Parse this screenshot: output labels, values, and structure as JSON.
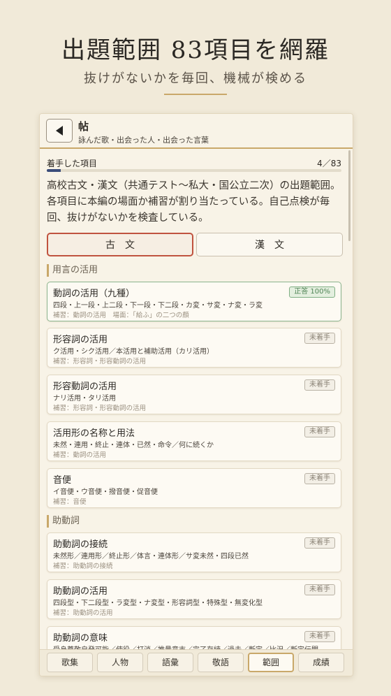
{
  "hero": {
    "title": "出題範囲 83項目を網羅",
    "subtitle": "抜けがないかを毎回、機械が検める"
  },
  "header": {
    "back_icon": "triangle-left-icon",
    "title": "帖",
    "subtitle": "詠んだ歌・出会った人・出会った言葉"
  },
  "progress": {
    "label": "着手した項目",
    "count": "4／83",
    "fraction": 0.048
  },
  "intro": "高校古文・漢文（共通テスト〜私大・国公立二次）の出題範囲。各項目に本編の場面か補習が割り当たっている。自己点検が毎回、抜けがないかを検査している。",
  "segments": {
    "kobun": "古文",
    "kanbun": "漢文",
    "selected": "kobun"
  },
  "sections": [
    {
      "title": "用言の活用"
    },
    {
      "title": "助動詞"
    }
  ],
  "items": [
    {
      "title": "動詞の活用（九種）",
      "desc": "四段・上一段・上二段・下一段・下二段・カ変・サ変・ナ変・ラ変",
      "ref": "補習：動詞の活用　場面：「給ふ」の二つの顔",
      "badge": "正答 100%",
      "status": "done"
    },
    {
      "title": "形容詞の活用",
      "desc": "ク活用・シク活用／本活用と補助活用（カリ活用）",
      "ref": "補習：形容詞・形容動詞の活用",
      "badge": "未着手",
      "status": "todo"
    },
    {
      "title": "形容動詞の活用",
      "desc": "ナリ活用・タリ活用",
      "ref": "補習：形容詞・形容動詞の活用",
      "badge": "未着手",
      "status": "todo"
    },
    {
      "title": "活用形の名称と用法",
      "desc": "未然・連用・終止・連体・已然・命令／何に続くか",
      "ref": "補習：動詞の活用",
      "badge": "未着手",
      "status": "todo"
    },
    {
      "title": "音便",
      "desc": "イ音便・ウ音便・撥音便・促音便",
      "ref": "補習：音便",
      "badge": "未着手",
      "status": "todo"
    },
    {
      "title": "助動詞の接続",
      "desc": "未然形／連用形／終止形／体言・連体形／サ変未然・四段已然",
      "ref": "補習：助動詞の接続",
      "badge": "未着手",
      "status": "todo"
    },
    {
      "title": "助動詞の活用",
      "desc": "四段型・下二段型・ラ変型・ナ変型・形容詞型・特殊型・無変化型",
      "ref": "補習：助動詞の活用",
      "badge": "未着手",
      "status": "todo"
    },
    {
      "title": "助動詞の意味",
      "desc": "受身尊敬自発可能／使役／打消／推量意志／完了存続／過去／断定／比況／断定伝聞",
      "ref": "",
      "badge": "未着手",
      "status": "todo"
    }
  ],
  "tabs": [
    {
      "label": "歌集"
    },
    {
      "label": "人物"
    },
    {
      "label": "語彙"
    },
    {
      "label": "敬語"
    },
    {
      "label": "範囲"
    },
    {
      "label": "成績"
    }
  ],
  "active_tab": "範囲"
}
